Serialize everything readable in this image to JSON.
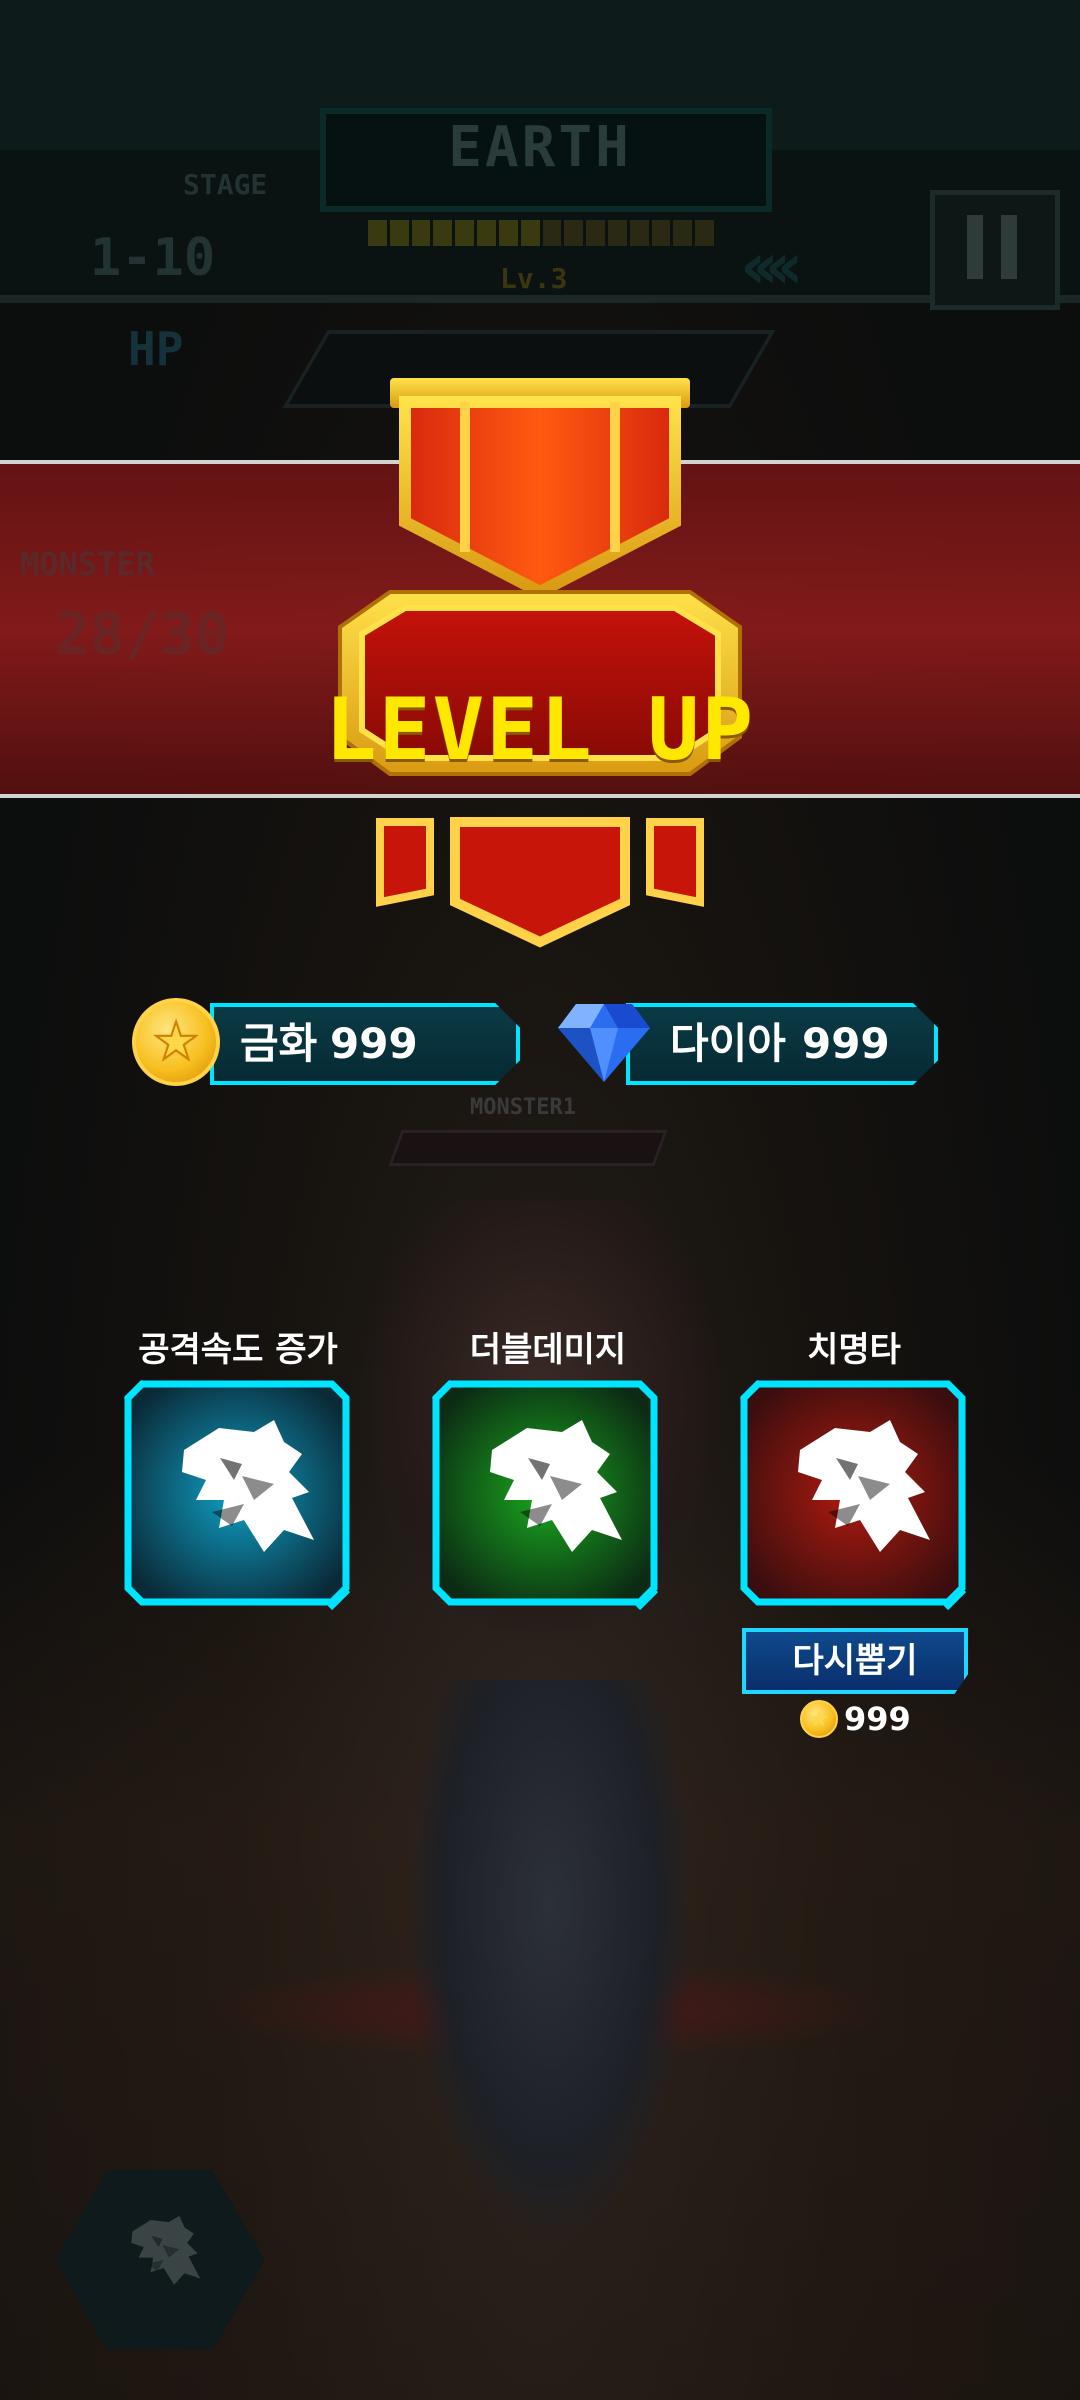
{
  "hud": {
    "world_title": "EARTH",
    "stage_label": "STAGE",
    "stage_value": "1-10",
    "level_label": "Lv.3",
    "hp_label": "HP",
    "monster_label": "MONSTER",
    "monster_count": "28/30",
    "monster_bar_label": "MONSTER1"
  },
  "level_up": {
    "title": "LEVEL UP"
  },
  "currency": {
    "gold_label": "금화",
    "gold_value": "999",
    "diamond_label": "다이아",
    "diamond_value": "999"
  },
  "skills": [
    {
      "title": "공격속도 증가",
      "color": "#0fa0c4",
      "icon": "dragon-claw-icon"
    },
    {
      "title": "더블데미지",
      "color": "#19a81e",
      "icon": "dragon-claw-icon"
    },
    {
      "title": "치명타",
      "color": "#b01a10",
      "icon": "dragon-claw-icon"
    }
  ],
  "reroll": {
    "label": "다시뽑기",
    "cost": "999"
  },
  "colors": {
    "cyan_border": "#00e5ff",
    "gold": "#f8c020",
    "banner_red": "#8f1c1c"
  }
}
